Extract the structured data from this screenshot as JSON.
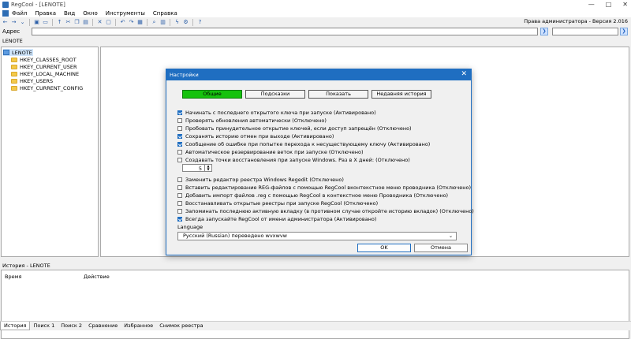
{
  "window": {
    "title": "RegCool - [LENOTE]"
  },
  "menu": [
    "Файл",
    "Правка",
    "Вид",
    "Окно",
    "Инструменты",
    "Справка"
  ],
  "toolbar": {
    "admin_info": "Права администратора - Версия 2.016"
  },
  "address": {
    "label": "Адрес",
    "value": "",
    "search_value": ""
  },
  "breadcrumb": "LENOTE",
  "tree": {
    "root": "LENOTE",
    "children": [
      "HKEY_CLASSES_ROOT",
      "HKEY_CURRENT_USER",
      "HKEY_LOCAL_MACHINE",
      "HKEY_USERS",
      "HKEY_CURRENT_CONFIG"
    ]
  },
  "history": {
    "title": "История - LENOTE",
    "col_time": "Время",
    "col_action": "Действие"
  },
  "bottom_tabs": [
    "История",
    "Поиск 1",
    "Поиск 2",
    "Сравнение",
    "Избранное",
    "Снимок реестра"
  ],
  "dialog": {
    "title": "Настройки",
    "tabs": [
      "Общие",
      "Подсказки",
      "Показать",
      "Недавняя история"
    ],
    "active_tab": "Общие",
    "options": [
      {
        "label": "Начинать с последнего открытого ключа при запуске (Активировано)",
        "checked": true
      },
      {
        "label": "Проверять обновления автоматически (Отключено)",
        "checked": false
      },
      {
        "label": "Пробовать принудительное открытие ключей, если доступ запрещён (Отключено)",
        "checked": false
      },
      {
        "label": "Сохранять историю отмен при выходе (Активировано)",
        "checked": true
      },
      {
        "label": "Сообщение об ошибке при попытке перехода к несуществующему ключу (Активировано)",
        "checked": true
      },
      {
        "label": "Автоматическое резервирование веток при запуске (Отключено)",
        "checked": false
      },
      {
        "label": "Создавать точки восстановления при запуске Windows. Раз в X дней: (Отключено)",
        "checked": false
      }
    ],
    "days_value": "5",
    "options2": [
      {
        "label": "Заменить редактор реестра Windows Regedit (Отключено)",
        "checked": false
      },
      {
        "label": "Вставить редактирование REG-файлов с помощью RegCool вконтекстное меню проводника (Отключено)",
        "checked": false
      },
      {
        "label": "Добавить импорт файлов .reg с помощью RegCool в контекстное меню Проводника (Отключено)",
        "checked": false
      },
      {
        "label": "Восстанавливать открытые реестры при запуске RegCool (Отключено)",
        "checked": false
      },
      {
        "label": "Запоминать последнюю активную вкладку (в противном случае откройте историю вкладок) (Отключено)",
        "checked": false
      },
      {
        "label": "Всегда запускайте RegCool от имени администратора (Активировано)",
        "checked": true
      }
    ],
    "language_label": "Language",
    "language_value": "Русский (Russian) переведено wvxwvw",
    "ok_label": "OK",
    "cancel_label": "Отмена"
  },
  "colors": {
    "accent": "#1f6ec1",
    "active_tab": "#16c20e"
  }
}
